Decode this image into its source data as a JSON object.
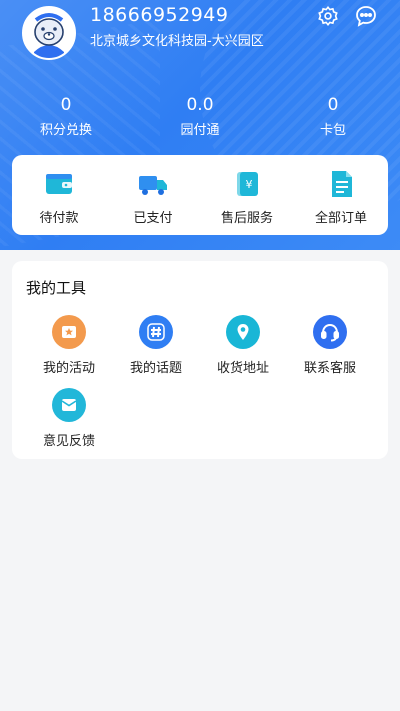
{
  "profile": {
    "phone": "18666952949",
    "organization": "北京城乡文化科技园-大兴园区"
  },
  "header_icons": [
    "settings-icon",
    "message-icon"
  ],
  "stats": [
    {
      "value": "0",
      "label": "积分兑换"
    },
    {
      "value": "0.0",
      "label": "园付通"
    },
    {
      "value": "0",
      "label": "卡包"
    }
  ],
  "orders": [
    {
      "label": "待付款",
      "icon": "wallet-icon"
    },
    {
      "label": "已支付",
      "icon": "truck-icon"
    },
    {
      "label": "售后服务",
      "icon": "receipt-icon"
    },
    {
      "label": "全部订单",
      "icon": "document-icon"
    }
  ],
  "tools": {
    "title": "我的工具",
    "items": [
      {
        "label": "我的活动",
        "icon": "activity-icon",
        "color": "#f39a4d"
      },
      {
        "label": "我的话题",
        "icon": "hashtag-icon",
        "color": "#2f7ef3"
      },
      {
        "label": "收货地址",
        "icon": "location-icon",
        "color": "#19b6d6"
      },
      {
        "label": "联系客服",
        "icon": "headset-icon",
        "color": "#2f6ff0"
      },
      {
        "label": "意见反馈",
        "icon": "feedback-icon",
        "color": "#22b7d9"
      }
    ]
  },
  "colors": {
    "accent_blue": "#2f7ef3",
    "icon_teal": "#1fb7d8",
    "background": "#f4f5f7"
  }
}
